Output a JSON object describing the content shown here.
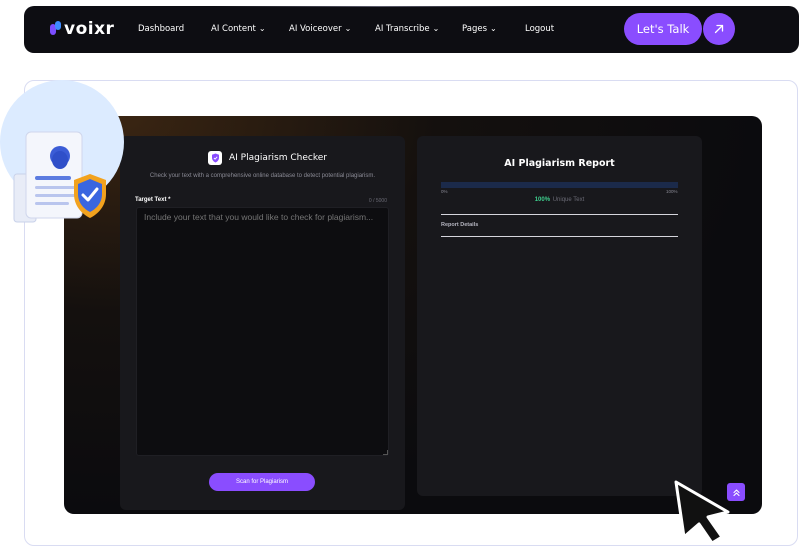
{
  "brand": {
    "logo_text": "voixr"
  },
  "nav": {
    "items": [
      {
        "label": "Dashboard",
        "has_dropdown": false
      },
      {
        "label": "AI Content",
        "has_dropdown": true
      },
      {
        "label": "AI Voiceover",
        "has_dropdown": true
      },
      {
        "label": "AI Transcribe",
        "has_dropdown": true
      },
      {
        "label": "Pages",
        "has_dropdown": true
      },
      {
        "label": "Logout",
        "has_dropdown": false
      }
    ],
    "cta_label": "Let's Talk",
    "cta_icon": "arrow-up-right-icon"
  },
  "checker": {
    "title": "AI Plagiarism Checker",
    "description": "Check your text with a comprehensive online database to detect potential plagiarism.",
    "target_label": "Target Text *",
    "char_count": "0 / 5000",
    "textarea_placeholder": "Include your text that you would like to check for plagiarism...",
    "textarea_value": "",
    "scan_button": "Scan for Plagiarism"
  },
  "report": {
    "title": "AI Plagiarism Report",
    "progress_min": "0%",
    "progress_max": "100%",
    "unique_percent": "100%",
    "unique_label": "Unique Text",
    "details_label": "Report Details"
  },
  "colors": {
    "accent": "#8a4dff",
    "unique_green": "#3ecf8e",
    "panel_bg": "#18181c",
    "nav_bg": "#0d0d12"
  }
}
